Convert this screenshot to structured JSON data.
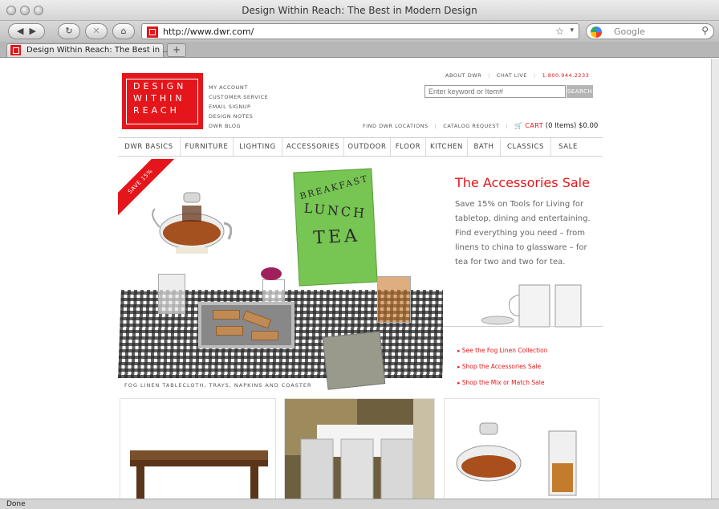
{
  "window": {
    "title": "Design Within Reach: The Best in Modern Design"
  },
  "toolbar": {
    "url": "http://www.dwr.com/",
    "search_placeholder": "Google"
  },
  "tabs": [
    {
      "label": "Design Within Reach: The Best in ..."
    }
  ],
  "status": {
    "text": "Done"
  },
  "site": {
    "logo_lines": [
      "DESIGN",
      "WITHIN",
      "REACH"
    ],
    "account_links": [
      "MY ACCOUNT",
      "CUSTOMER SERVICE",
      "EMAIL SIGNUP",
      "DESIGN NOTES",
      "DWR BLOG"
    ],
    "top_links": {
      "about": "ABOUT DWR",
      "chat": "CHAT LIVE",
      "phone": "1.800.944.2233"
    },
    "search": {
      "placeholder": "Enter keyword or Item#",
      "button": "SEARCH"
    },
    "util": {
      "locations": "FIND DWR LOCATIONS",
      "catalog": "CATALOG REQUEST",
      "cart_label": "CART",
      "cart_info": "(0 Items) $0.00"
    },
    "nav": [
      "DWR BASICS",
      "FURNITURE",
      "LIGHTING",
      "ACCESSORIES",
      "OUTDOOR",
      "FLOOR",
      "KITCHEN",
      "BATH",
      "CLASSICS",
      "SALE"
    ]
  },
  "hero": {
    "ribbon": "SAVE 15%",
    "book_lines": [
      "BREAKFAST",
      "LUNCH",
      "TEA"
    ],
    "caption": "FOG LINEN TABLECLOTH, TRAYS, NAPKINS AND COASTER",
    "promo_title": "The Accessories Sale",
    "promo_body": "Save 15% on Tools for Living for tabletop, dining and entertaining. Find everything you need – from linens to china to glassware – for tea for two and two for tea.",
    "links": [
      "See the Fog Linen Collection",
      "Shop the Accessories Sale",
      "Shop the Mix or Match Sale"
    ]
  },
  "colors": {
    "brand_red": "#e4161b"
  }
}
